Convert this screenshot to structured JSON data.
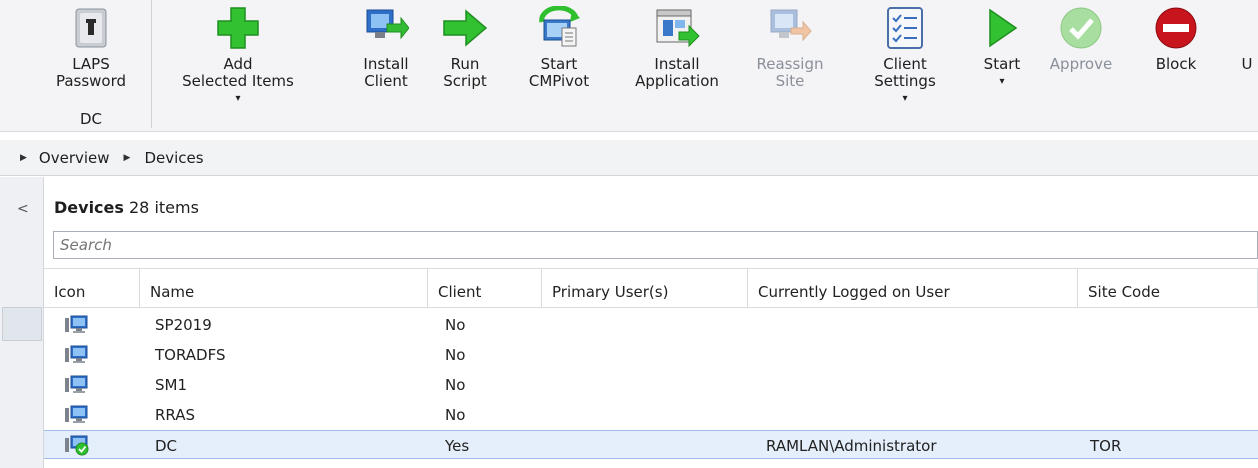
{
  "ribbon": {
    "laps": {
      "line1": "LAPS",
      "line2": "Password",
      "group": "DC"
    },
    "add": {
      "line1": "Add",
      "line2": "Selected Items"
    },
    "install_client": {
      "line1": "Install",
      "line2": "Client"
    },
    "run_script": {
      "line1": "Run",
      "line2": "Script"
    },
    "start_cmpivot": {
      "line1": "Start",
      "line2": "CMPivot"
    },
    "install_app": {
      "line1": "Install",
      "line2": "Application"
    },
    "reassign": {
      "line1": "Reassign",
      "line2": "Site"
    },
    "client_settings": {
      "line1": "Client",
      "line2": "Settings"
    },
    "start": {
      "line1": "Start"
    },
    "approve": {
      "line1": "Approve"
    },
    "block": {
      "line1": "Block"
    },
    "partial": {
      "line1": "U"
    },
    "caret": "▾"
  },
  "breadcrumb": {
    "items": [
      "Overview",
      "Devices"
    ]
  },
  "panel": {
    "title": "Devices",
    "count": "28 items"
  },
  "search": {
    "placeholder": "Search"
  },
  "table": {
    "columns": [
      "Icon",
      "Name",
      "Client",
      "Primary User(s)",
      "Currently Logged on User",
      "Site Code"
    ],
    "rows": [
      {
        "name": "SP2019",
        "client": "No",
        "primary": "",
        "logged": "",
        "site": ""
      },
      {
        "name": "TORADFS",
        "client": "No",
        "primary": "",
        "logged": "",
        "site": ""
      },
      {
        "name": "SM1",
        "client": "No",
        "primary": "",
        "logged": "",
        "site": ""
      },
      {
        "name": "RRAS",
        "client": "No",
        "primary": "",
        "logged": "",
        "site": ""
      },
      {
        "name": "DC",
        "client": "Yes",
        "primary": "",
        "logged": "RAMLAN\\Administrator",
        "site": "TOR"
      }
    ]
  },
  "colors": {
    "accent_green": "#2fbf2f",
    "selected_row": "#e5eefb",
    "block_red": "#c8141c"
  }
}
